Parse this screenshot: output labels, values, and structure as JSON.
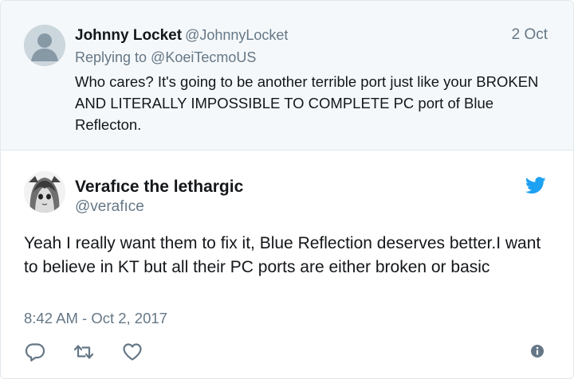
{
  "parent_tweet": {
    "author_name": "Johnny Locket",
    "author_handle": "@JohnnyLocket",
    "date": "2 Oct",
    "replying_to": "Replying to @KoeiTecmoUS",
    "text": "Who cares? It's going to be another terrible port just like your BROKEN AND LITERALLY IMPOSSIBLE TO COMPLETE PC port of Blue Reflecton."
  },
  "main_tweet": {
    "author_name": "Verafıce the lethargic",
    "author_handle": "@verafıce",
    "text": "Yeah I really want them to fix it, Blue Reflection deserves better.I want to believe in KT but all their PC ports are either broken or basic",
    "timestamp": "8:42 AM - Oct 2, 2017"
  },
  "icons": {
    "reply": "reply-icon",
    "retweet": "retweet-icon",
    "like": "heart-icon",
    "info": "info-icon",
    "brand": "twitter-bird-icon"
  },
  "colors": {
    "twitter_blue": "#1da1f2",
    "secondary_text": "#657786",
    "parent_background": "#f5f8fa",
    "action_icon": "#657786"
  }
}
